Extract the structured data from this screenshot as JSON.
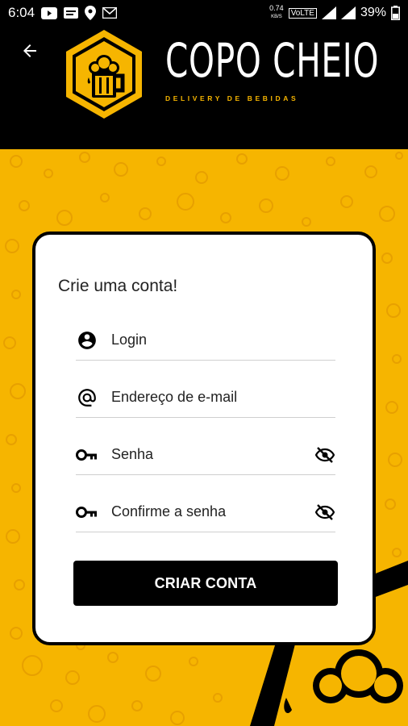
{
  "status_bar": {
    "time": "6:04",
    "data_rate": "0.74",
    "data_unit": "KB/S",
    "network": "VoLTE",
    "battery": "39%"
  },
  "header": {
    "brand_name": "COPO CHEIO",
    "brand_tagline": "DELIVERY DE BEBIDAS",
    "colors": {
      "background": "#000000",
      "accent": "#f6b500"
    }
  },
  "form": {
    "title": "Crie uma conta!",
    "fields": [
      {
        "label": "Login",
        "icon": "account-circle-icon"
      },
      {
        "label": "Endereço de e-mail",
        "icon": "at-sign-icon"
      },
      {
        "label": "Senha",
        "icon": "key-icon",
        "toggle_icon": "eye-off-icon"
      },
      {
        "label": "Confirme a senha",
        "icon": "key-icon",
        "toggle_icon": "eye-off-icon"
      }
    ],
    "submit_label": "CRIAR CONTA"
  }
}
